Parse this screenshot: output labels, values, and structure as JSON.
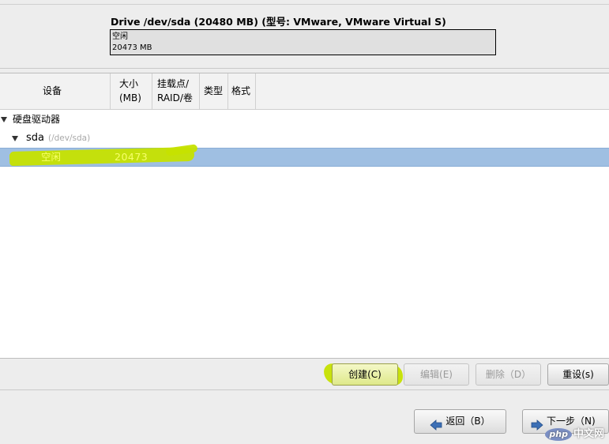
{
  "drive": {
    "title": "Drive /dev/sda (20480 MB) (型号: VMware, VMware Virtual S)",
    "bar_label": "空闲",
    "bar_size": "20473 MB"
  },
  "table": {
    "headers": {
      "device": "设备",
      "size_line1": "大小",
      "size_line2": "(MB)",
      "mount_line1": "挂载点/",
      "mount_line2": "RAID/卷",
      "type": "类型",
      "format": "格式"
    },
    "tree": {
      "group_label": "硬盘驱动器",
      "disk_name": "sda",
      "disk_path": "(/dev/sda)",
      "free_label": "空闲",
      "free_size": "20473"
    }
  },
  "actions": {
    "create": "创建(C)",
    "edit": "编辑(E)",
    "delete": "删除（D）",
    "reset": "重设(s)"
  },
  "navigation": {
    "back": "返回（B）",
    "next": "下一步（N)"
  },
  "watermark": {
    "badge": "php",
    "text": "中文网"
  },
  "colors": {
    "selection": "#9fbfe2",
    "highlighter": "#c6e200",
    "highlight_text": "#f7ff6a",
    "nav_arrow": "#3c6fb5"
  }
}
